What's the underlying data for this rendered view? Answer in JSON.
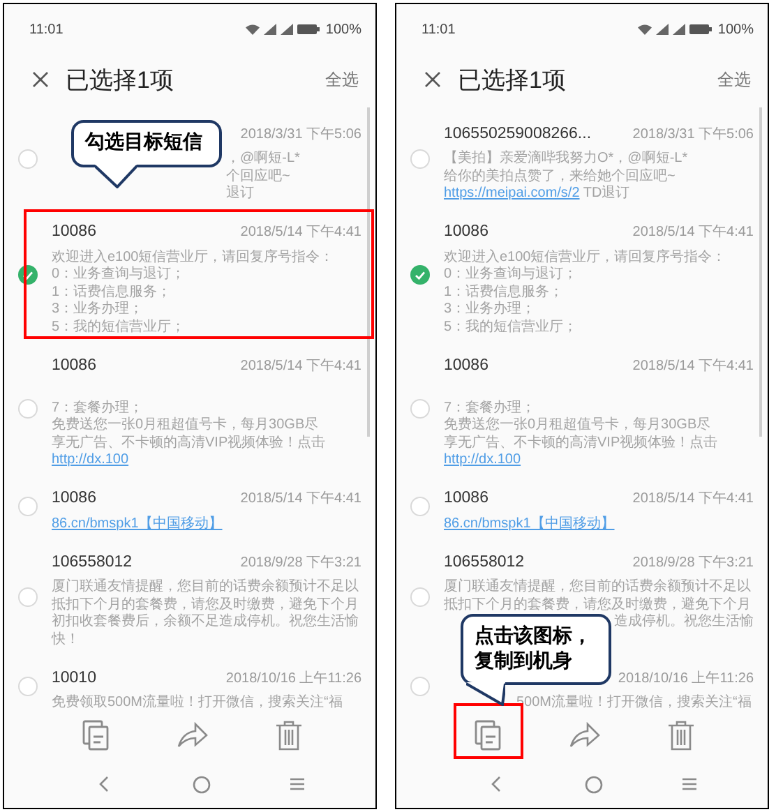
{
  "panels": [
    {
      "status": {
        "time": "11:01",
        "battery": "100%"
      },
      "title": "已选择1项",
      "select_all": "全选",
      "callout": {
        "text": "勾选目标短信"
      },
      "toolbar": [
        {
          "kind": "copy",
          "highlighted": false
        },
        {
          "kind": "share",
          "highlighted": false
        },
        {
          "kind": "delete",
          "highlighted": false
        }
      ],
      "messages": [
        {
          "date": "2018/3/31 下午5:06",
          "selected": false,
          "lines": [
            {
              "kind": "after_callout",
              "text": "，@啊短-L*"
            },
            {
              "kind": "after_callout",
              "text": "个回应吧~"
            },
            {
              "kind": "after_callout",
              "text": "退订"
            }
          ]
        },
        {
          "sender": "10086",
          "date": "2018/5/14 下午4:41",
          "selected": true,
          "highlighted": true,
          "lines": [
            {
              "kind": "text",
              "text": "欢迎进入e100短信营业厅，请回复序号指令："
            },
            {
              "kind": "text",
              "text": "0：业务查询与退订；"
            },
            {
              "kind": "text",
              "text": "1：话费信息服务；"
            },
            {
              "kind": "text",
              "text": "3：业务办理；"
            },
            {
              "kind": "text",
              "text": "5：我的短信营业厅；"
            }
          ]
        },
        {
          "sender": "10086",
          "date": "2018/5/14 下午4:41",
          "selected": false,
          "lines": [
            {
              "kind": "blank"
            },
            {
              "kind": "text",
              "text": "7：套餐办理；"
            },
            {
              "kind": "text",
              "text": "免费送您一张0月租超值号卡，每月30GB尽"
            },
            {
              "kind": "text",
              "text": "享无广告、不卡顿的高清VIP视频体验！点击"
            },
            {
              "kind": "link",
              "text": "http://dx.100"
            }
          ]
        },
        {
          "sender": "10086",
          "date": "2018/5/14 下午4:41",
          "selected": false,
          "lines": [
            {
              "kind": "link",
              "text": "86.cn/bmspk1【中国移动】"
            }
          ]
        },
        {
          "sender": "106558012",
          "date": "2018/9/28 下午3:21",
          "selected": false,
          "lines": [
            {
              "kind": "text",
              "text": "厦门联通友情提醒，您目前的话费余额预计不足以"
            },
            {
              "kind": "text",
              "text": "抵扣下个月的套餐费，请您及时缴费，避免下个月"
            },
            {
              "kind": "text",
              "text": "初扣收套餐费后，余额不足造成停机。祝您生活愉"
            },
            {
              "kind": "text",
              "text": "快！"
            }
          ]
        },
        {
          "sender": "10010",
          "date": "2018/10/16 上午11:26",
          "selected": false,
          "lines": [
            {
              "kind": "text",
              "text": "免费领取500M流量啦！打开微信，搜索关注“福"
            }
          ]
        }
      ]
    },
    {
      "status": {
        "time": "11:01",
        "battery": "100%"
      },
      "title": "已选择1项",
      "select_all": "全选",
      "callout": {
        "text": "点击该图标，复制到机身"
      },
      "toolbar": [
        {
          "kind": "copy",
          "highlighted": true
        },
        {
          "kind": "share",
          "highlighted": false
        },
        {
          "kind": "delete",
          "highlighted": false
        }
      ],
      "messages": [
        {
          "sender": "106550259008266...",
          "date": "2018/3/31 下午5:06",
          "selected": false,
          "lines": [
            {
              "kind": "text",
              "text": "【美拍】亲爱滴哔我努力O*，@啊短-L*"
            },
            {
              "kind": "text",
              "text": "给你的美拍点赞了，来给她个回应吧~"
            },
            {
              "kind": "mixed",
              "link": "https://meipai.com/s/2",
              "text": " TD退订"
            }
          ]
        },
        {
          "sender": "10086",
          "date": "2018/5/14 下午4:41",
          "selected": true,
          "lines": [
            {
              "kind": "text",
              "text": "欢迎进入e100短信营业厅，请回复序号指令："
            },
            {
              "kind": "text",
              "text": "0：业务查询与退订；"
            },
            {
              "kind": "text",
              "text": "1：话费信息服务；"
            },
            {
              "kind": "text",
              "text": "3：业务办理；"
            },
            {
              "kind": "text",
              "text": "5：我的短信营业厅；"
            }
          ]
        },
        {
          "sender": "10086",
          "date": "2018/5/14 下午4:41",
          "selected": false,
          "lines": [
            {
              "kind": "blank"
            },
            {
              "kind": "text",
              "text": "7：套餐办理；"
            },
            {
              "kind": "text",
              "text": "免费送您一张0月租超值号卡，每月30GB尽"
            },
            {
              "kind": "text",
              "text": "享无广告、不卡顿的高清VIP视频体验！点击"
            },
            {
              "kind": "link",
              "text": "http://dx.100"
            }
          ]
        },
        {
          "sender": "10086",
          "date": "2018/5/14 下午4:41",
          "selected": false,
          "lines": [
            {
              "kind": "link",
              "text": "86.cn/bmspk1【中国移动】"
            }
          ]
        },
        {
          "sender": "106558012",
          "date": "2018/9/28 下午3:21",
          "selected": false,
          "lines": [
            {
              "kind": "text",
              "text": "厦门联通友情提醒，您目前的话费余额预计不足以"
            },
            {
              "kind": "text",
              "text": "抵扣下个月的套餐费，请您及时缴费，避免下个月"
            },
            {
              "kind": "after_callout",
              "text": "造成停机。祝您生活愉"
            },
            {
              "kind": "blank"
            }
          ]
        },
        {
          "date": "2018/10/16 上午11:26",
          "selected": false,
          "lines": [
            {
              "kind": "after_pointer",
              "text": "500M流量啦！打开微信，搜索关注“福"
            }
          ]
        }
      ]
    }
  ]
}
